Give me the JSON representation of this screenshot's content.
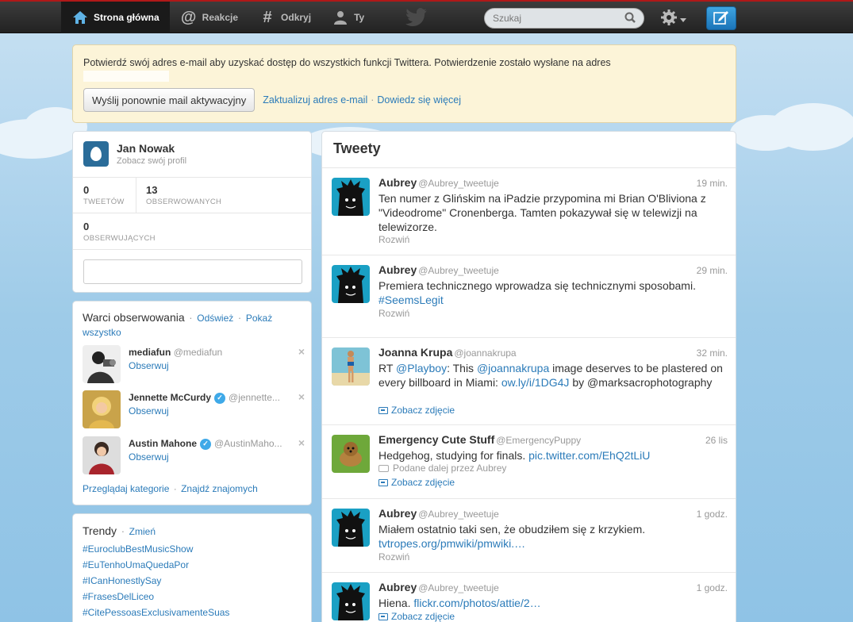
{
  "nav": {
    "home": "Strona główna",
    "connect": "Reakcje",
    "discover": "Odkryj",
    "me": "Ty"
  },
  "search": {
    "placeholder": "Szukaj"
  },
  "alert": {
    "text": "Potwierdź swój adres e-mail aby uzyskać dostęp do wszystkich funkcji Twittera. Potwierdzenie zostało wysłane na adres",
    "resend_button": "Wyślij ponownie mail aktywacyjny",
    "update_email": "Zaktualizuj adres e-mail",
    "learn_more": "Dowiedz się więcej",
    "sep": "·"
  },
  "profile": {
    "name": "Jan Nowak",
    "subtitle": "Zobacz swój profil",
    "tweets_count": "0",
    "tweets_label": "TWEETÓW",
    "following_count": "13",
    "following_label": "OBSERWOWANYCH",
    "followers_count": "0",
    "followers_label": "OBSERWUJĄCYCH"
  },
  "who_to_follow": {
    "title": "Warci obserwowania",
    "refresh": "Odśwież",
    "show_all_1": "Pokaż",
    "show_all_2": "wszystko",
    "sep": "·",
    "follow_label": "Obserwuj",
    "close": "×",
    "items": [
      {
        "name": "mediafun",
        "handle": "@mediafun"
      },
      {
        "name": "Jennette McCurdy",
        "handle": "@jennette..."
      },
      {
        "name": "Austin Mahone",
        "handle": "@AustinMaho..."
      }
    ],
    "browse": "Przeglądaj kategorie",
    "find_friends": "Znajdź znajomych"
  },
  "trends": {
    "title": "Trendy",
    "change": "Zmień",
    "sep": "·",
    "items": [
      "#EuroclubBestMusicShow",
      "#EuTenhoUmaQuedaPor",
      "#ICanHonestlySay",
      "#FrasesDelLiceo",
      "#CitePessoasExclusivamenteSuas"
    ]
  },
  "stream": {
    "title": "Tweety",
    "tweets": [
      {
        "name": "Aubrey",
        "handle": "@Aubrey_tweetuje",
        "time": "19 min.",
        "text": "Ten numer z Glińskim na iPadzie przypomina mi Brian O'Bliviona z \"Videodrome\" Cronenberga. Tamten pokazywał się w telewizji na telewizorze.",
        "action": "Rozwiń"
      },
      {
        "name": "Aubrey",
        "handle": "@Aubrey_tweetuje",
        "time": "29 min.",
        "text": "Premiera technicznego wprowadza się technicznymi sposobami.",
        "hashtag": "#SeemsLegit",
        "action": "Rozwiń"
      },
      {
        "name": "Joanna Krupa",
        "handle": "@joannakrupa",
        "time": "32 min.",
        "text_rt": "RT",
        "mention1": "@Playboy",
        "text_mid": ": This",
        "mention2": "@joannakrupa",
        "text_mid2": "image deserves to be plastered on every billboard in Miami:",
        "link": "ow.ly/i/1DG4J",
        "text_end": "by @marksacrophotography",
        "action": "Zobacz zdjęcie"
      },
      {
        "name": "Emergency Cute Stuff",
        "handle": "@EmergencyPuppy",
        "time": "26 lis",
        "text": "Hedgehog, studying for finals.",
        "link": "pic.twitter.com/EhQ2tLiU",
        "retweeted_by": "Podane dalej przez Aubrey",
        "action": "Zobacz zdjęcie"
      },
      {
        "name": "Aubrey",
        "handle": "@Aubrey_tweetuje",
        "time": "1 godz.",
        "text": "Miałem ostatnio taki sen, że obudziłem się z krzykiem.",
        "link": "tvtropes.org/pmwiki/pmwiki.…",
        "action": "Rozwiń"
      },
      {
        "name": "Aubrey",
        "handle": "@Aubrey_tweetuje",
        "time": "1 godz.",
        "text": "Hiena.",
        "link": "flickr.com/photos/attie/2…",
        "action": "Zobacz zdjęcie"
      }
    ]
  },
  "colors": {
    "accent": "#2b7bb9",
    "topbar": "#222222",
    "alert_bg": "#fcf4d8"
  }
}
